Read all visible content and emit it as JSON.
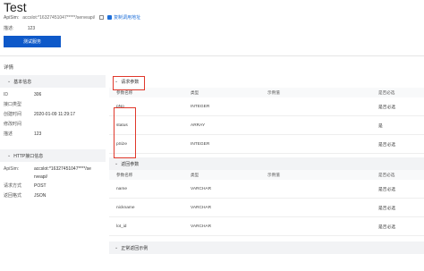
{
  "page": {
    "title": "Test"
  },
  "api": {
    "label": "ApiSim:",
    "value": "accslot:*16327451047*****/serveapi/",
    "link_label": "复制调用地址"
  },
  "desc": {
    "label": "描述:",
    "value": "123"
  },
  "primary_button": "测试服务",
  "details_label": "详情",
  "basic_info": {
    "title": "基本信息",
    "rows": [
      {
        "k": "ID",
        "v": "306"
      },
      {
        "k": "接口类型",
        "v": ""
      },
      {
        "k": "创建时间",
        "v": "2020-01-09 11:29:17"
      },
      {
        "k": "修改时间",
        "v": ""
      },
      {
        "k": "描述",
        "v": "123"
      }
    ]
  },
  "http_info": {
    "title": "HTTP接口信息",
    "rows": [
      {
        "k": "ApiSim:",
        "v": "accslot:*16327451047****/se"
      },
      {
        "k": "",
        "v": "rveapi/"
      },
      {
        "k": "请求方式",
        "v": "POST"
      },
      {
        "k": "返回格式",
        "v": "JSON"
      }
    ]
  },
  "request_params": {
    "title": "请求参数",
    "columns": [
      "参数名称",
      "类型",
      "示例值",
      "是否必选"
    ],
    "rows": [
      {
        "name": "pNo",
        "type": "INTEGER",
        "example": "",
        "required": "是否必选"
      },
      {
        "name": "status",
        "type": "ARRAY",
        "example": "",
        "required": "是"
      },
      {
        "name": "pSize",
        "type": "INTEGER",
        "example": "",
        "required": "是否必选"
      }
    ]
  },
  "return_params": {
    "title": "返回参数",
    "columns": [
      "参数名称",
      "类型",
      "示例值",
      "是否必选"
    ],
    "rows": [
      {
        "name": "name",
        "type": "VARCHAR",
        "example": "",
        "required": "是否必选"
      },
      {
        "name": "nickname",
        "type": "VARCHAR",
        "example": "",
        "required": "是否必选"
      },
      {
        "name": "lot_id",
        "type": "VARCHAR",
        "example": "",
        "required": "是否必选"
      }
    ]
  },
  "normal_example": {
    "title": "正常返回示例"
  },
  "colors": {
    "primary": "#0e59c9",
    "highlight": "#e0382b"
  }
}
